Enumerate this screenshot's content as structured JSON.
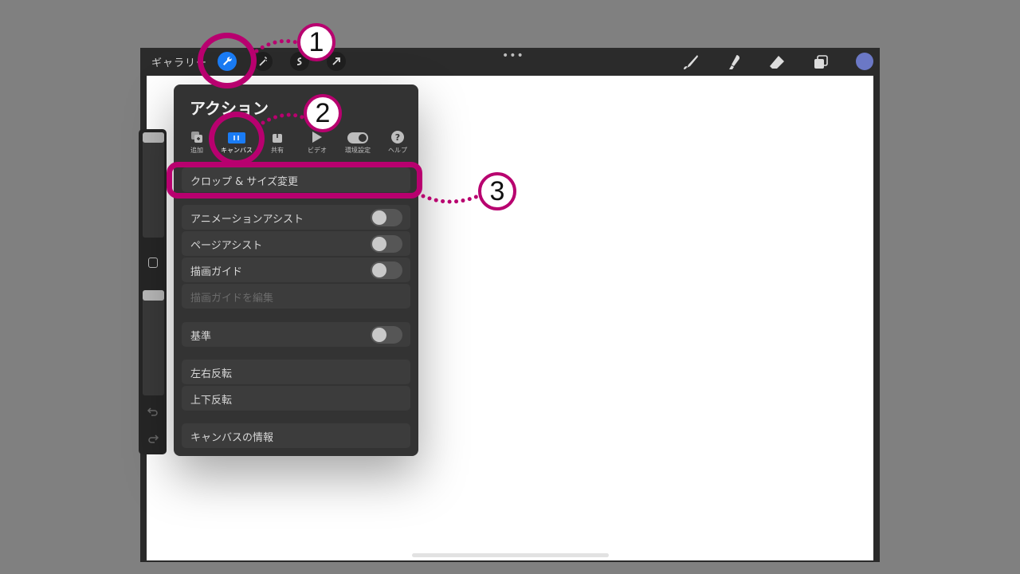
{
  "toolbar": {
    "gallery_label": "ギャラリー",
    "more_label": "•••",
    "current_color": "#6b78c6",
    "icons": [
      "wrench-icon",
      "magic-wand-icon",
      "selection-icon",
      "transform-arrow-icon",
      "brush-icon",
      "smudge-icon",
      "eraser-icon",
      "layers-icon"
    ]
  },
  "panel": {
    "title": "アクション",
    "tabs": [
      {
        "label": "追加",
        "icon": "add-icon"
      },
      {
        "label": "キャンバス",
        "icon": "canvas-icon",
        "active": true
      },
      {
        "label": "共有",
        "icon": "share-icon"
      },
      {
        "label": "ビデオ",
        "icon": "video-play-icon"
      },
      {
        "label": "環境設定",
        "icon": "toggle-icon"
      },
      {
        "label": "ヘルプ",
        "icon": "help-icon"
      }
    ],
    "rows": {
      "crop": "クロップ & サイズ変更",
      "animation": "アニメーションアシスト",
      "page": "ページアシスト",
      "guide": "描画ガイド",
      "edit_guide": "描画ガイドを編集",
      "reference": "基準",
      "flip_h": "左右反転",
      "flip_v": "上下反転",
      "info": "キャンバスの情報"
    }
  },
  "callouts": {
    "one": "1",
    "two": "2",
    "three": "3",
    "color": "#b8006f"
  }
}
